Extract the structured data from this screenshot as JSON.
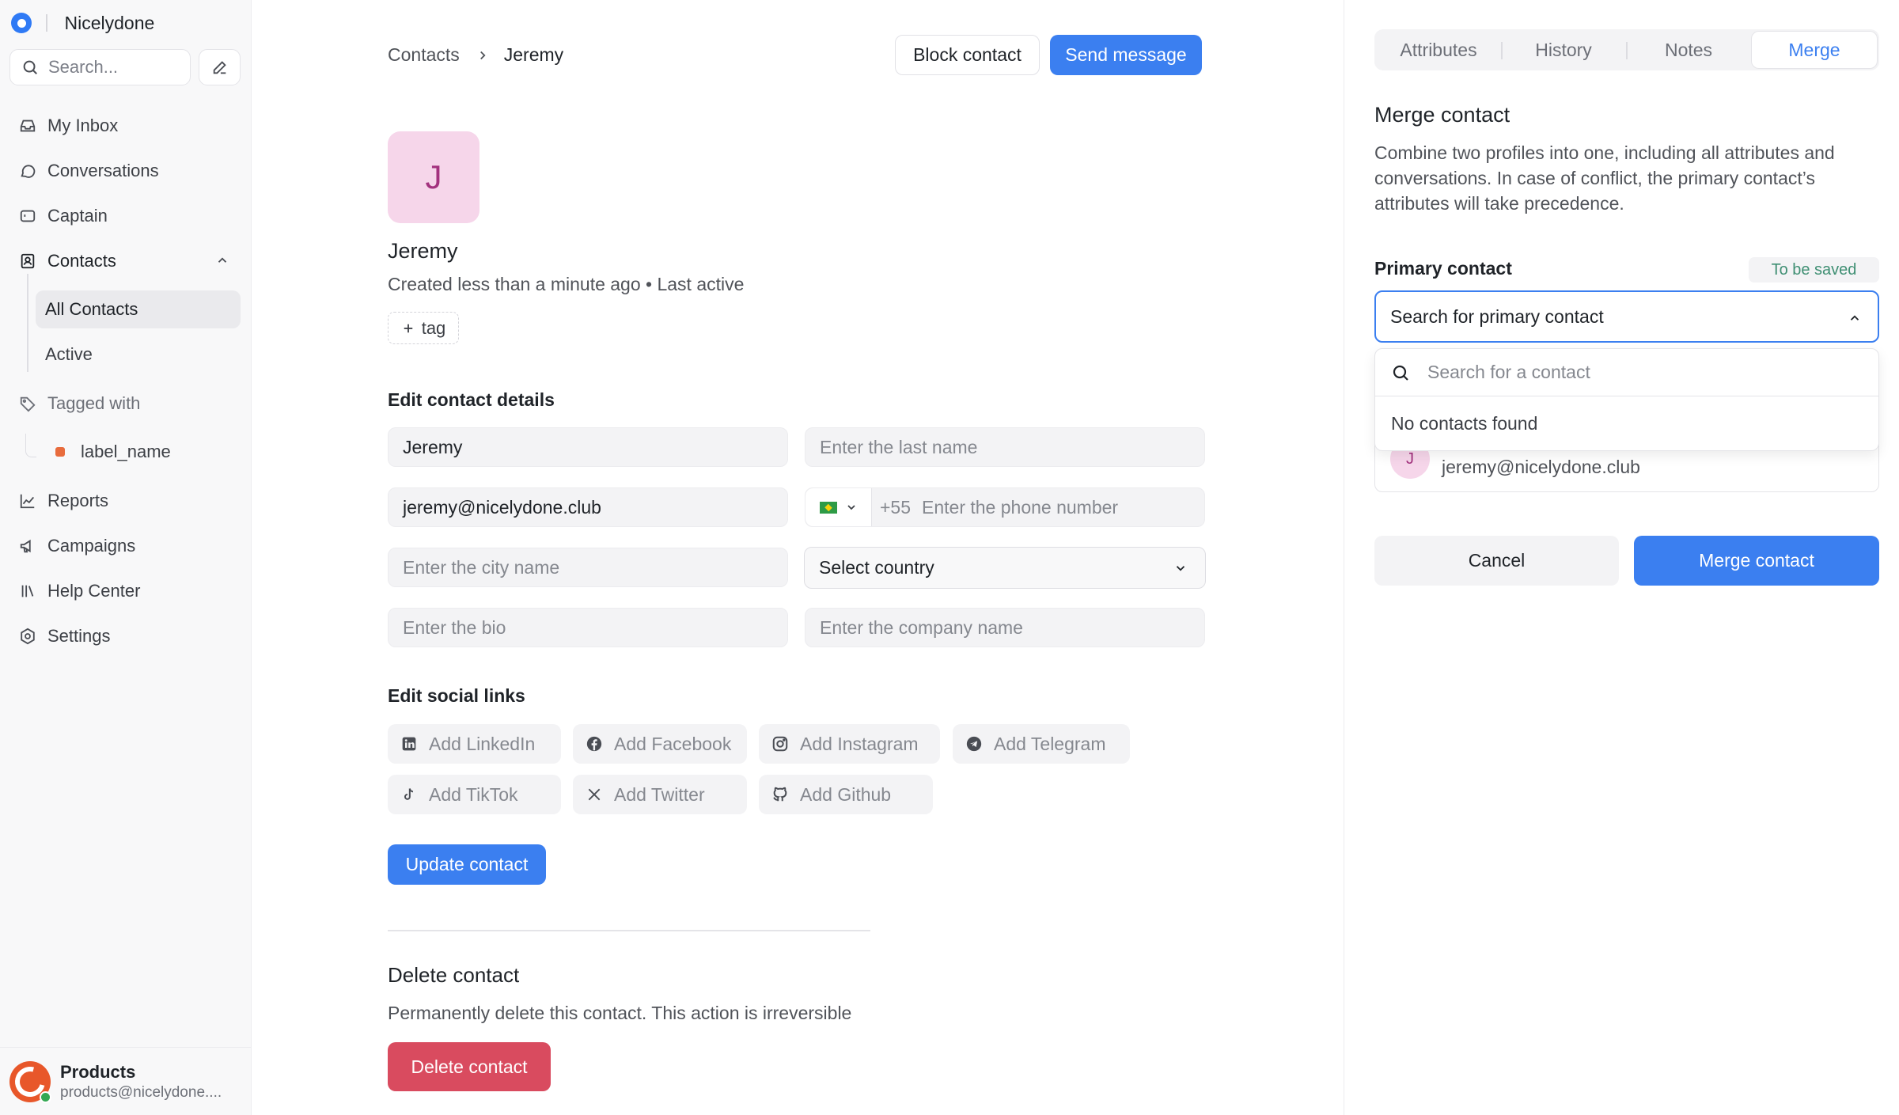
{
  "app": {
    "name": "Nicelydone"
  },
  "sidebar": {
    "search_placeholder": "Search...",
    "items": [
      {
        "label": "My Inbox",
        "icon": "inbox-icon"
      },
      {
        "label": "Conversations",
        "icon": "chat-bubble-icon"
      },
      {
        "label": "Captain",
        "icon": "bot-icon"
      },
      {
        "label": "Contacts",
        "icon": "contacts-icon"
      },
      {
        "label": "Reports",
        "icon": "chart-icon"
      },
      {
        "label": "Campaigns",
        "icon": "megaphone-icon"
      },
      {
        "label": "Help Center",
        "icon": "library-icon"
      },
      {
        "label": "Settings",
        "icon": "gear-icon"
      }
    ],
    "contacts_sub": [
      {
        "label": "All Contacts",
        "active": true
      },
      {
        "label": "Active",
        "active": false
      }
    ],
    "tagged_with": "Tagged with",
    "label_name": "label_name",
    "label_color": "#e86c3d",
    "profile": {
      "name": "Products",
      "email": "products@nicelydone...."
    }
  },
  "main": {
    "breadcrumb": {
      "parent": "Contacts",
      "current": "Jeremy"
    },
    "block_button": "Block contact",
    "send_button": "Send message",
    "avatar_initial": "J",
    "name": "Jeremy",
    "meta": "Created less than a minute ago • Last active",
    "tag_button": "tag",
    "details_title": "Edit contact details",
    "fields": {
      "first_name": "Jeremy",
      "last_name_placeholder": "Enter the last name",
      "email": "jeremy@nicelydone.club",
      "phone_code": "+55",
      "phone_placeholder": "Enter the phone number",
      "city_placeholder": "Enter the city name",
      "country_select": "Select country",
      "bio_placeholder": "Enter the bio",
      "company_placeholder": "Enter the company name"
    },
    "social_title": "Edit social links",
    "social": {
      "linkedin": "Add LinkedIn",
      "facebook": "Add Facebook",
      "instagram": "Add Instagram",
      "telegram": "Add Telegram",
      "tiktok": "Add TikTok",
      "twitter": "Add Twitter",
      "github": "Add Github"
    },
    "update_button": "Update contact",
    "delete_title": "Delete contact",
    "delete_desc": "Permanently delete this contact. This action is irreversible",
    "delete_button": "Delete contact"
  },
  "panel": {
    "tabs": [
      "Attributes",
      "History",
      "Notes",
      "Merge"
    ],
    "active_tab": "Merge",
    "title": "Merge contact",
    "description": "Combine two profiles into one, including all attributes and conversations. In case of conflict, the primary contact’s attributes will take precedence.",
    "primary_label": "Primary contact",
    "badge": "To be saved",
    "combo_value": "Search for primary contact",
    "dropdown_search_placeholder": "Search for a contact",
    "dropdown_empty": "No contacts found",
    "secondary_initial": "J",
    "secondary_email": "jeremy@nicelydone.club",
    "cancel_button": "Cancel",
    "merge_button": "Merge contact"
  },
  "colors": {
    "accent": "#3b7ff0",
    "danger": "#d94b5f",
    "badge_text": "#3f8f73"
  }
}
